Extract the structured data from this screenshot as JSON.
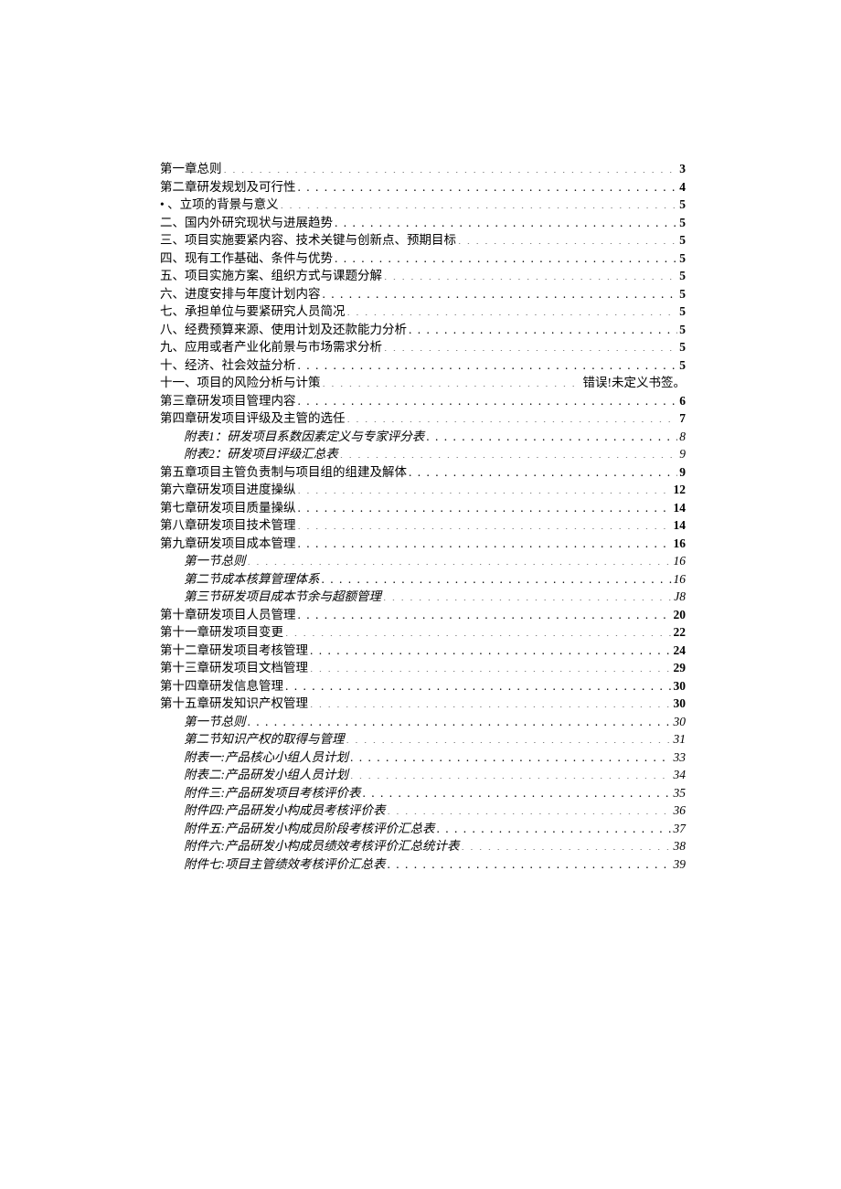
{
  "toc": [
    {
      "title": "第一章总则",
      "page": "3",
      "italic": false,
      "indent": false,
      "pageStyle": "bold"
    },
    {
      "title": "第二章研发规划及可行性",
      "page": "4",
      "italic": false,
      "indent": false,
      "pageStyle": "bold"
    },
    {
      "title": "  • 、立项的背景与意义",
      "page": "5",
      "italic": false,
      "indent": false,
      "pageStyle": "bold"
    },
    {
      "title": "二、国内外研究现状与进展趋势",
      "page": "5",
      "italic": false,
      "indent": false,
      "pageStyle": "bold"
    },
    {
      "title": "三、项目实施要紧内容、技术关键与创新点、预期目标",
      "page": "5",
      "italic": false,
      "indent": false,
      "pageStyle": "bold"
    },
    {
      "title": "四、现有工作基础、条件与优势",
      "page": "5",
      "italic": false,
      "indent": false,
      "pageStyle": "bold"
    },
    {
      "title": "五、项目实施方案、组织方式与课题分解",
      "page": "5",
      "italic": false,
      "indent": false,
      "pageStyle": "bold"
    },
    {
      "title": "六、进度安排与年度计划内容",
      "page": "5",
      "italic": false,
      "indent": false,
      "pageStyle": "bold"
    },
    {
      "title": "七、承担单位与要紧研究人员简况",
      "page": "5",
      "italic": false,
      "indent": false,
      "pageStyle": "bold"
    },
    {
      "title": "八、经费预算来源、使用计划及还款能力分析",
      "page": "5",
      "italic": false,
      "indent": false,
      "pageStyle": "bold"
    },
    {
      "title": "九、应用或者产业化前景与市场需求分析",
      "page": "5",
      "italic": false,
      "indent": false,
      "pageStyle": "bold"
    },
    {
      "title": "十、经济、社会效益分析",
      "page": "5",
      "italic": false,
      "indent": false,
      "pageStyle": "bold"
    },
    {
      "title": "十一、项目的风险分析与计策",
      "page": "错误!未定义书签。",
      "italic": false,
      "indent": false,
      "pageStyle": "error"
    },
    {
      "title": "第三章研发项目管理内容",
      "page": "6",
      "italic": false,
      "indent": false,
      "pageStyle": "bold"
    },
    {
      "title": "第四章研发项目评级及主管的选任",
      "page": "7",
      "italic": false,
      "indent": false,
      "pageStyle": "bold"
    },
    {
      "title": "附表1：研发项目系数因素定义与专家评分表",
      "page": "8",
      "italic": true,
      "indent": true,
      "pageStyle": "italic"
    },
    {
      "title": "附表2：研发项目评级汇总表",
      "page": "9",
      "italic": true,
      "indent": true,
      "pageStyle": "italic"
    },
    {
      "title": "第五章项目主管负责制与项目组的组建及解体",
      "page": "9",
      "italic": false,
      "indent": false,
      "pageStyle": "bold"
    },
    {
      "title": "第六章研发项目进度操纵",
      "page": "12",
      "italic": false,
      "indent": false,
      "pageStyle": "bold"
    },
    {
      "title": "第七章研发项目质量操纵",
      "page": "14",
      "italic": false,
      "indent": false,
      "pageStyle": "bold"
    },
    {
      "title": "第八章研发项目技术管理",
      "page": "14",
      "italic": false,
      "indent": false,
      "pageStyle": "bold"
    },
    {
      "title": "第九章研发项目成本管理",
      "page": "16",
      "italic": false,
      "indent": false,
      "pageStyle": "bold"
    },
    {
      "title": "第一节总则",
      "page": "16",
      "italic": true,
      "indent": true,
      "pageStyle": "italic"
    },
    {
      "title": "第二节成本核算管理体系",
      "page": "16",
      "italic": true,
      "indent": true,
      "pageStyle": "italic"
    },
    {
      "title": "第三节研发项目成本节余与超额管理",
      "page": "J8",
      "italic": true,
      "indent": true,
      "pageStyle": "italic"
    },
    {
      "title": "第十章研发项目人员管理",
      "page": "20",
      "italic": false,
      "indent": false,
      "pageStyle": "bold"
    },
    {
      "title": "第十一章研发项目变更",
      "page": "22",
      "italic": false,
      "indent": false,
      "pageStyle": "bold"
    },
    {
      "title": "第十二章研发项目考核管理",
      "page": "24",
      "italic": false,
      "indent": false,
      "pageStyle": "bold"
    },
    {
      "title": "第十三章研发项目文档管理",
      "page": "29",
      "italic": false,
      "indent": false,
      "pageStyle": "bold"
    },
    {
      "title": "第十四章研发信息管理",
      "page": "30",
      "italic": false,
      "indent": false,
      "pageStyle": "bold"
    },
    {
      "title": "第十五章研发知识产权管理",
      "page": "30",
      "italic": false,
      "indent": false,
      "pageStyle": "bold"
    },
    {
      "title": "第一节总则",
      "page": "30",
      "italic": true,
      "indent": true,
      "pageStyle": "italic"
    },
    {
      "title": "第二节知识产权的取得与管理",
      "page": "31",
      "italic": true,
      "indent": true,
      "pageStyle": "italic"
    },
    {
      "title": "附表一:产品核心小组人员计划",
      "page": "33",
      "italic": true,
      "indent": true,
      "pageStyle": "italic"
    },
    {
      "title": "附表二:产品研发小组人员计划",
      "page": "34",
      "italic": true,
      "indent": true,
      "pageStyle": "italic"
    },
    {
      "title": "附件三:产品研发项目考核评价表",
      "page": "35",
      "italic": true,
      "indent": true,
      "pageStyle": "italic"
    },
    {
      "title": "附件四:产品研发小构成员考核评价表",
      "page": "36",
      "italic": true,
      "indent": true,
      "pageStyle": "italic"
    },
    {
      "title": "附件五:产品研发小构成员阶段考核评价汇总表",
      "page": "37",
      "italic": true,
      "indent": true,
      "pageStyle": "italic"
    },
    {
      "title": "附件六:产品研发小构成员绩效考核评价汇总统计表",
      "page": "38",
      "italic": true,
      "indent": true,
      "pageStyle": "italic"
    },
    {
      "title": "附件七:项目主管绩效考核评价汇总表",
      "page": "39",
      "italic": true,
      "indent": true,
      "pageStyle": "italic"
    }
  ]
}
